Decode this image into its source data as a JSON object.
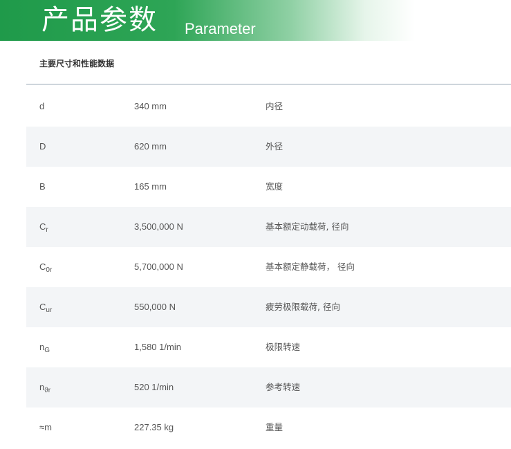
{
  "banner": {
    "title_cn": "产品参数",
    "title_en": "Parameter"
  },
  "section_title": "主要尺寸和性能数据",
  "rows": [
    {
      "symbol": "d",
      "sub": "",
      "value": "340 mm",
      "desc": "内径"
    },
    {
      "symbol": "D",
      "sub": "",
      "value": "620 mm",
      "desc": "外径"
    },
    {
      "symbol": "B",
      "sub": "",
      "value": "165 mm",
      "desc": "宽度"
    },
    {
      "symbol": "C",
      "sub": "r",
      "value": "3,500,000 N",
      "desc": "基本额定动载荷, 径向"
    },
    {
      "symbol": "C",
      "sub": "0r",
      "value": "5,700,000 N",
      "desc": "基本额定静载荷， 径向"
    },
    {
      "symbol": "C",
      "sub": "ur",
      "value": "550,000 N",
      "desc": "疲劳极限载荷, 径向"
    },
    {
      "symbol": "n",
      "sub": "G",
      "value": "1,580 1/min",
      "desc": "极限转速"
    },
    {
      "symbol": "n",
      "sub": "ϑr",
      "value": "520 1/min",
      "desc": "参考转速"
    },
    {
      "symbol": "≈m",
      "sub": "",
      "value": "227.35 kg",
      "desc": "重量"
    }
  ],
  "colors": {
    "banner_green": "#1f9a4a",
    "row_shade": "#f3f5f7",
    "divider": "#cfd6dc"
  }
}
